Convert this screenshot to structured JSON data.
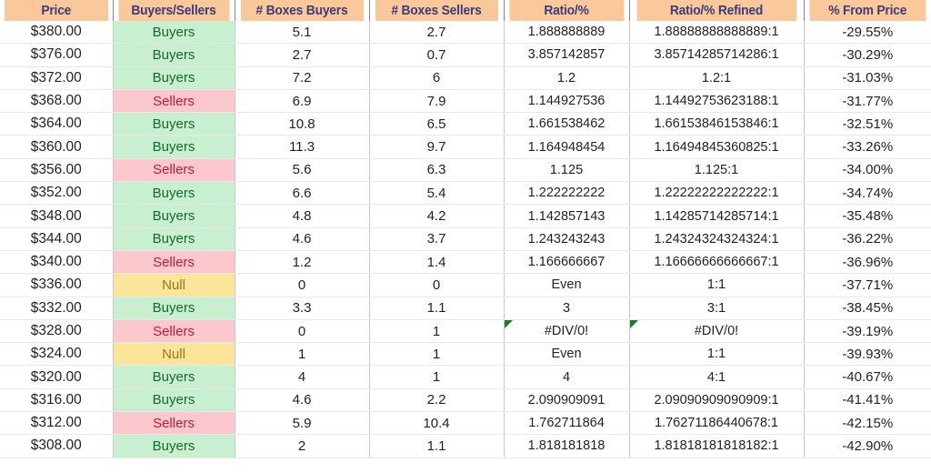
{
  "table": {
    "columns": [
      {
        "key": "price",
        "label": "Price"
      },
      {
        "key": "bs",
        "label": "Buyers/Sellers"
      },
      {
        "key": "boxes_buyers",
        "label": "# Boxes Buyers"
      },
      {
        "key": "boxes_sellers",
        "label": "# Boxes Sellers"
      },
      {
        "key": "ratio",
        "label": "Ratio/%"
      },
      {
        "key": "ratio_refined",
        "label": "Ratio/% Refined"
      },
      {
        "key": "pct_from_price",
        "label": "% From Price"
      }
    ],
    "colors": {
      "header_bg": "#f9c99c",
      "header_text": "#3f3a78",
      "buyers_bg": "#c7efd0",
      "buyers_text": "#17682b",
      "sellers_bg": "#fcc8ce",
      "sellers_text": "#bb1d37",
      "null_bg": "#fbe59b",
      "null_text": "#9a7418",
      "error_marker": "#1d7a27",
      "cell_text": "#222222",
      "grid_line": "#e8e8e8"
    },
    "rows": [
      {
        "price": "$380.00",
        "bs": "Buyers",
        "bs_state": "buyers",
        "boxes_buyers": "5.1",
        "boxes_sellers": "2.7",
        "ratio": "1.888888889",
        "ratio_refined": "1.88888888888889:1",
        "pct_from_price": "-29.55%",
        "error": false
      },
      {
        "price": "$376.00",
        "bs": "Buyers",
        "bs_state": "buyers",
        "boxes_buyers": "2.7",
        "boxes_sellers": "0.7",
        "ratio": "3.857142857",
        "ratio_refined": "3.85714285714286:1",
        "pct_from_price": "-30.29%",
        "error": false
      },
      {
        "price": "$372.00",
        "bs": "Buyers",
        "bs_state": "buyers",
        "boxes_buyers": "7.2",
        "boxes_sellers": "6",
        "ratio": "1.2",
        "ratio_refined": "1.2:1",
        "pct_from_price": "-31.03%",
        "error": false
      },
      {
        "price": "$368.00",
        "bs": "Sellers",
        "bs_state": "sellers",
        "boxes_buyers": "6.9",
        "boxes_sellers": "7.9",
        "ratio": "1.144927536",
        "ratio_refined": "1.14492753623188:1",
        "pct_from_price": "-31.77%",
        "error": false
      },
      {
        "price": "$364.00",
        "bs": "Buyers",
        "bs_state": "buyers",
        "boxes_buyers": "10.8",
        "boxes_sellers": "6.5",
        "ratio": "1.661538462",
        "ratio_refined": "1.66153846153846:1",
        "pct_from_price": "-32.51%",
        "error": false
      },
      {
        "price": "$360.00",
        "bs": "Buyers",
        "bs_state": "buyers",
        "boxes_buyers": "11.3",
        "boxes_sellers": "9.7",
        "ratio": "1.164948454",
        "ratio_refined": "1.16494845360825:1",
        "pct_from_price": "-33.26%",
        "error": false
      },
      {
        "price": "$356.00",
        "bs": "Sellers",
        "bs_state": "sellers",
        "boxes_buyers": "5.6",
        "boxes_sellers": "6.3",
        "ratio": "1.125",
        "ratio_refined": "1.125:1",
        "pct_from_price": "-34.00%",
        "error": false
      },
      {
        "price": "$352.00",
        "bs": "Buyers",
        "bs_state": "buyers",
        "boxes_buyers": "6.6",
        "boxes_sellers": "5.4",
        "ratio": "1.222222222",
        "ratio_refined": "1.22222222222222:1",
        "pct_from_price": "-34.74%",
        "error": false
      },
      {
        "price": "$348.00",
        "bs": "Buyers",
        "bs_state": "buyers",
        "boxes_buyers": "4.8",
        "boxes_sellers": "4.2",
        "ratio": "1.142857143",
        "ratio_refined": "1.14285714285714:1",
        "pct_from_price": "-35.48%",
        "error": false
      },
      {
        "price": "$344.00",
        "bs": "Buyers",
        "bs_state": "buyers",
        "boxes_buyers": "4.6",
        "boxes_sellers": "3.7",
        "ratio": "1.243243243",
        "ratio_refined": "1.24324324324324:1",
        "pct_from_price": "-36.22%",
        "error": false
      },
      {
        "price": "$340.00",
        "bs": "Sellers",
        "bs_state": "sellers",
        "boxes_buyers": "1.2",
        "boxes_sellers": "1.4",
        "ratio": "1.166666667",
        "ratio_refined": "1.16666666666667:1",
        "pct_from_price": "-36.96%",
        "error": false
      },
      {
        "price": "$336.00",
        "bs": "Null",
        "bs_state": "null",
        "boxes_buyers": "0",
        "boxes_sellers": "0",
        "ratio": "Even",
        "ratio_refined": "1:1",
        "pct_from_price": "-37.71%",
        "error": false
      },
      {
        "price": "$332.00",
        "bs": "Buyers",
        "bs_state": "buyers",
        "boxes_buyers": "3.3",
        "boxes_sellers": "1.1",
        "ratio": "3",
        "ratio_refined": "3:1",
        "pct_from_price": "-38.45%",
        "error": false
      },
      {
        "price": "$328.00",
        "bs": "Sellers",
        "bs_state": "sellers",
        "boxes_buyers": "0",
        "boxes_sellers": "1",
        "ratio": "#DIV/0!",
        "ratio_refined": "#DIV/0!",
        "pct_from_price": "-39.19%",
        "error": true
      },
      {
        "price": "$324.00",
        "bs": "Null",
        "bs_state": "null",
        "boxes_buyers": "1",
        "boxes_sellers": "1",
        "ratio": "Even",
        "ratio_refined": "1:1",
        "pct_from_price": "-39.93%",
        "error": false
      },
      {
        "price": "$320.00",
        "bs": "Buyers",
        "bs_state": "buyers",
        "boxes_buyers": "4",
        "boxes_sellers": "1",
        "ratio": "4",
        "ratio_refined": "4:1",
        "pct_from_price": "-40.67%",
        "error": false
      },
      {
        "price": "$316.00",
        "bs": "Buyers",
        "bs_state": "buyers",
        "boxes_buyers": "4.6",
        "boxes_sellers": "2.2",
        "ratio": "2.090909091",
        "ratio_refined": "2.09090909090909:1",
        "pct_from_price": "-41.41%",
        "error": false
      },
      {
        "price": "$312.00",
        "bs": "Sellers",
        "bs_state": "sellers",
        "boxes_buyers": "5.9",
        "boxes_sellers": "10.4",
        "ratio": "1.762711864",
        "ratio_refined": "1.76271186440678:1",
        "pct_from_price": "-42.15%",
        "error": false
      },
      {
        "price": "$308.00",
        "bs": "Buyers",
        "bs_state": "buyers",
        "boxes_buyers": "2",
        "boxes_sellers": "1.1",
        "ratio": "1.818181818",
        "ratio_refined": "1.81818181818182:1",
        "pct_from_price": "-42.90%",
        "error": false
      }
    ]
  }
}
